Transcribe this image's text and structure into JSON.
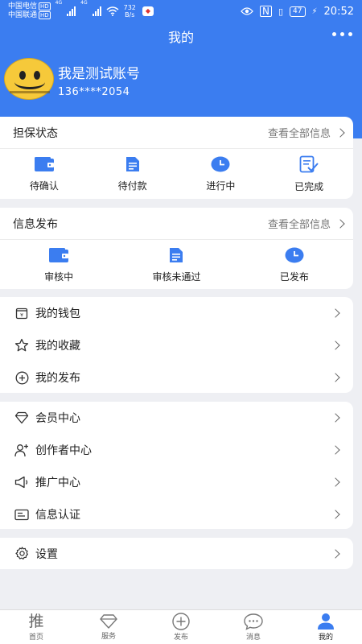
{
  "status_bar": {
    "carrier1": "中国电信",
    "carrier2": "中国联通",
    "hd": "HD",
    "net1": "4G",
    "net2": "4G",
    "speed_value": "732",
    "speed_unit": "B/s",
    "battery": "47",
    "time": "20:52"
  },
  "header": {
    "title": "我的"
  },
  "profile": {
    "name": "我是测试账号",
    "phone": "136****2054"
  },
  "guarantee": {
    "title": "担保状态",
    "view_all": "查看全部信息",
    "items": [
      {
        "label": "待确认",
        "icon": "wallet-icon"
      },
      {
        "label": "待付款",
        "icon": "document-icon"
      },
      {
        "label": "进行中",
        "icon": "clock-icon"
      },
      {
        "label": "已完成",
        "icon": "checklist-icon"
      }
    ]
  },
  "publish": {
    "title": "信息发布",
    "view_all": "查看全部信息",
    "items": [
      {
        "label": "审核中",
        "icon": "wallet-icon"
      },
      {
        "label": "审核未通过",
        "icon": "document-icon"
      },
      {
        "label": "已发布",
        "icon": "clock-icon"
      }
    ]
  },
  "menu1": [
    {
      "label": "我的钱包",
      "icon": "wallet-outline-icon"
    },
    {
      "label": "我的收藏",
      "icon": "star-icon"
    },
    {
      "label": "我的发布",
      "icon": "plus-circle-icon"
    }
  ],
  "menu2": [
    {
      "label": "会员中心",
      "icon": "diamond-icon"
    },
    {
      "label": "创作者中心",
      "icon": "user-plus-icon"
    },
    {
      "label": "推广中心",
      "icon": "megaphone-icon"
    },
    {
      "label": "信息认证",
      "icon": "id-card-icon"
    }
  ],
  "menu3": [
    {
      "label": "设置",
      "icon": "gear-icon"
    }
  ],
  "bottom_nav": [
    {
      "label": "首页",
      "glyph": "推",
      "icon": "home-icon"
    },
    {
      "label": "服务",
      "icon": "diamond-icon"
    },
    {
      "label": "发布",
      "icon": "plus-circle-icon"
    },
    {
      "label": "消息",
      "icon": "chat-icon"
    },
    {
      "label": "我的",
      "icon": "user-icon",
      "active": true
    }
  ],
  "colors": {
    "primary": "#3b7df0",
    "background": "#eeeff3"
  }
}
